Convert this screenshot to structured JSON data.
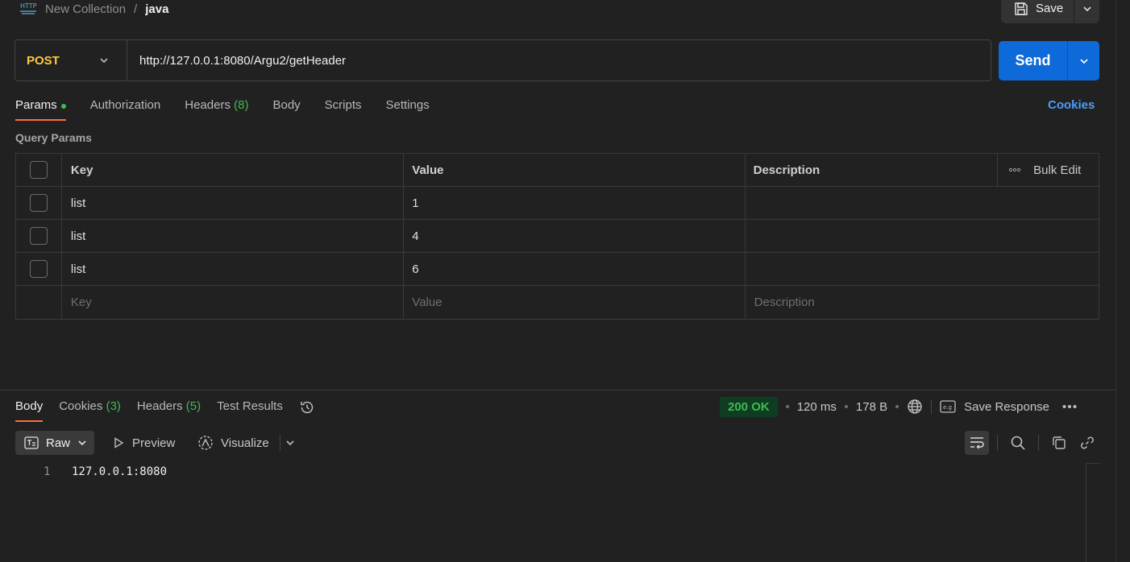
{
  "breadcrumb": {
    "icon": "http-icon",
    "collection": "New Collection",
    "separator": "/",
    "request": "java"
  },
  "toolbar": {
    "save_label": "Save"
  },
  "request": {
    "method": "POST",
    "method_color": "#ffc940",
    "url": "http://127.0.0.1:8080/Argu2/getHeader",
    "send_label": "Send",
    "send_color": "#0d6ad8"
  },
  "request_tabs": [
    {
      "label": "Params",
      "active": true,
      "dot": true
    },
    {
      "label": "Authorization"
    },
    {
      "label": "Headers",
      "count": "(8)"
    },
    {
      "label": "Body"
    },
    {
      "label": "Scripts"
    },
    {
      "label": "Settings"
    }
  ],
  "cookies_link": "Cookies",
  "query_params": {
    "title": "Query Params",
    "columns": {
      "key": "Key",
      "value": "Value",
      "description": "Description",
      "bulk_edit": "Bulk Edit"
    },
    "rows": [
      {
        "key": "list",
        "value": "1",
        "description": ""
      },
      {
        "key": "list",
        "value": "4",
        "description": ""
      },
      {
        "key": "list",
        "value": "6",
        "description": ""
      }
    ],
    "placeholders": {
      "key": "Key",
      "value": "Value",
      "description": "Description"
    }
  },
  "response_tabs": [
    {
      "label": "Body",
      "active": true
    },
    {
      "label": "Cookies",
      "count": "(3)"
    },
    {
      "label": "Headers",
      "count": "(5)"
    },
    {
      "label": "Test Results"
    }
  ],
  "response_status": {
    "code": "200 OK",
    "time": "120 ms",
    "size": "178 B",
    "save_response": "Save Response"
  },
  "response_toolbar": {
    "format": "Raw",
    "preview": "Preview",
    "visualize": "Visualize"
  },
  "response_body": {
    "lines": [
      {
        "num": "1",
        "text": "127.0.0.1:8080"
      }
    ]
  },
  "colors": {
    "background": "#212121",
    "accent_tab": "#ff6c37",
    "link": "#4d9dfb",
    "success": "#3fb950"
  }
}
